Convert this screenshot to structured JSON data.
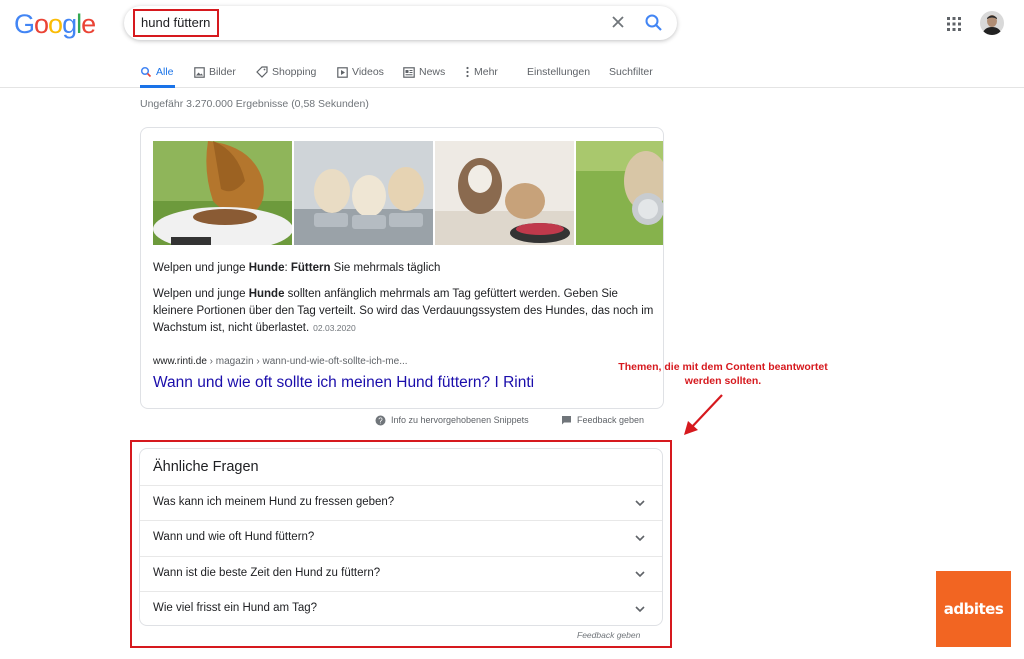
{
  "header": {
    "logo_letters": [
      {
        "ch": "G",
        "color": "#4285F4"
      },
      {
        "ch": "o",
        "color": "#EA4335"
      },
      {
        "ch": "o",
        "color": "#FBBC05"
      },
      {
        "ch": "g",
        "color": "#4285F4"
      },
      {
        "ch": "l",
        "color": "#34A853"
      },
      {
        "ch": "e",
        "color": "#EA4335"
      }
    ],
    "query": "hund füttern",
    "icons": {
      "clear": "close-icon",
      "search": "search-icon",
      "apps": "apps-grid-icon",
      "account": "avatar"
    }
  },
  "tabs": [
    {
      "label": "Alle",
      "icon": "search-icon",
      "active": true
    },
    {
      "label": "Bilder",
      "icon": "image-icon",
      "active": false
    },
    {
      "label": "Shopping",
      "icon": "tag-icon",
      "active": false
    },
    {
      "label": "Videos",
      "icon": "play-icon",
      "active": false
    },
    {
      "label": "News",
      "icon": "news-icon",
      "active": false
    },
    {
      "label": "Mehr",
      "icon": "more-dots-icon",
      "active": false
    },
    {
      "label": "Einstellungen",
      "icon": "",
      "active": false
    },
    {
      "label": "Suchfilter",
      "icon": "",
      "active": false
    }
  ],
  "result_stats": "Ungefähr 3.270.000 Ergebnisse (0,58 Sekunden)",
  "snippet": {
    "heading": {
      "pre": "Welpen und junge ",
      "b1": "Hunde",
      "mid": ": ",
      "b2": "Füttern",
      "post": " Sie mehrmals täglich"
    },
    "body": {
      "pre": "Welpen und junge ",
      "bold": "Hunde",
      "post": " sollten anfänglich mehrmals am Tag gefüttert werden. Geben Sie kleinere Portionen über den Tag verteilt. So wird das Verdauungssystem des Hundes, das noch im Wachstum ist, nicht überlastet."
    },
    "date": "02.03.2020",
    "domain": "www.rinti.de",
    "path": " › magazin › wann-und-wie-oft-sollte-ich-me...",
    "link": "Wann und wie oft sollte ich meinen Hund füttern? I Rinti",
    "footer_info": "Info zu hervorgehobenen Snippets",
    "footer_feedback": "Feedback geben"
  },
  "related": {
    "title": "Ähnliche Fragen",
    "questions": [
      "Was kann ich meinem Hund zu fressen geben?",
      "Wann und wie oft Hund füttern?",
      "Wann ist die beste Zeit den Hund zu füttern?",
      "Wie viel frisst ein Hund am Tag?"
    ],
    "feedback": "Feedback geben"
  },
  "annotation": {
    "line1": "Themen, die mit dem Content beantwortet",
    "line2": "werden sollten."
  },
  "brand": "adbites",
  "colors": {
    "accent_blue": "#1a73e8",
    "link": "#1a0dab",
    "highlight_red": "#d6191e",
    "brand_orange": "#f26522"
  }
}
